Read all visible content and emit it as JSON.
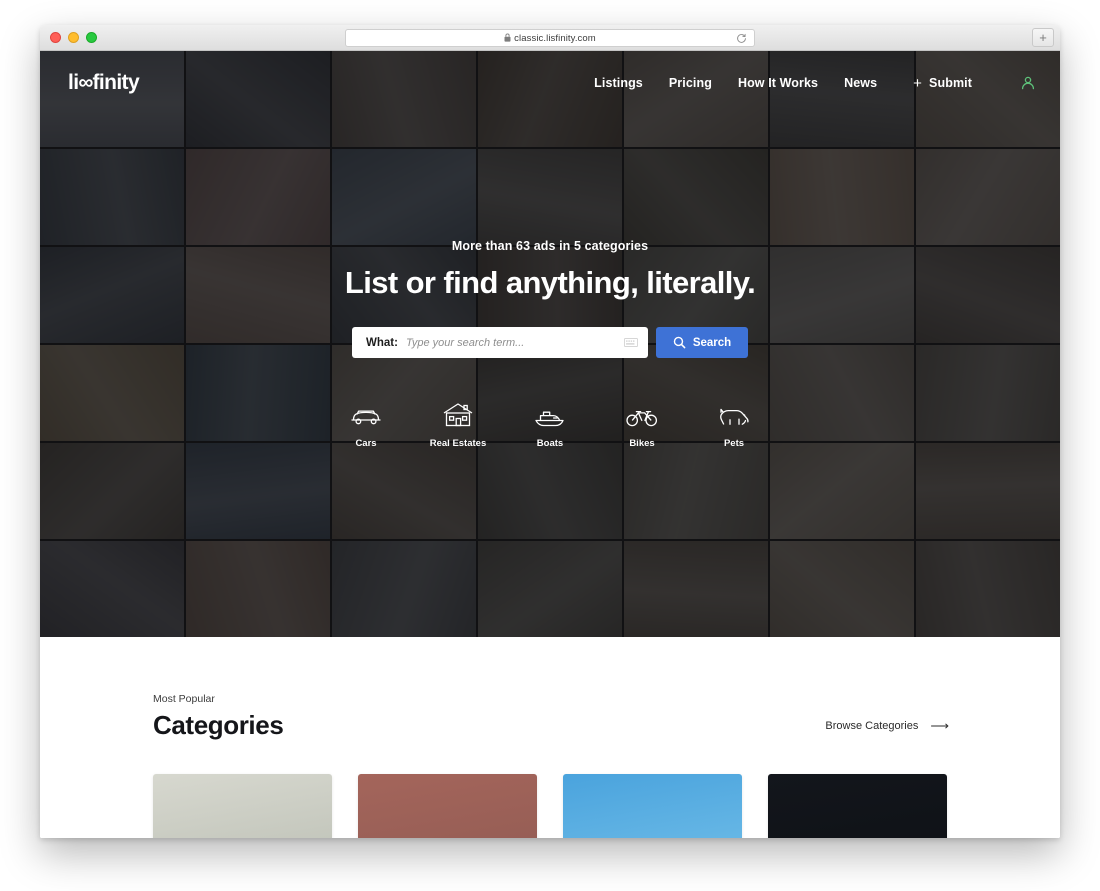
{
  "browser": {
    "url": "classic.lisfinity.com",
    "lock_icon": "lock-icon",
    "reload_icon": "reload-icon",
    "new_tab_label": "+",
    "traffic_lights": [
      "close",
      "minimize",
      "maximize"
    ]
  },
  "header": {
    "logo_pre": "li",
    "logo_infinity": "∞",
    "logo_post": "finity",
    "nav": [
      {
        "label": "Listings"
      },
      {
        "label": "Pricing"
      },
      {
        "label": "How It Works"
      },
      {
        "label": "News"
      }
    ],
    "submit": {
      "plus": "+",
      "label": "Submit"
    },
    "account_icon": "user-icon"
  },
  "hero": {
    "kicker": "More than 63 ads in 5 categories",
    "title": "List or find anything, literally.",
    "search": {
      "what_label": "What:",
      "placeholder": "Type your search term...",
      "value": "",
      "keyboard_icon": "keyboard-icon",
      "button_label": "Search",
      "button_icon": "search-icon",
      "button_color": "#3e72d6"
    },
    "shortcuts": [
      {
        "label": "Cars",
        "icon": "car-icon"
      },
      {
        "label": "Real Estates",
        "icon": "house-icon"
      },
      {
        "label": "Boats",
        "icon": "boat-icon"
      },
      {
        "label": "Bikes",
        "icon": "bicycle-icon"
      },
      {
        "label": "Pets",
        "icon": "dog-icon"
      }
    ],
    "overlay_color": "#0c0c0e",
    "mosaic": [
      "#5d6168",
      "#3a3d42",
      "#58514a",
      "#50473c",
      "#6a6258",
      "#4a4a48",
      "#6b6256",
      "#41484f",
      "#6b5a56",
      "#4a5560",
      "#52504b",
      "#4d4a40",
      "#7a6b5c",
      "#736a60",
      "#3c4249",
      "#6e6057",
      "#3e4348",
      "#4d463e",
      "#5b5a52",
      "#6d6a64",
      "#524c45",
      "#70644f",
      "#3b4852",
      "#6a6358",
      "#46433c",
      "#585043",
      "#6b645a",
      "#5e5a52",
      "#4f4a42",
      "#3f4a56",
      "#5a5248",
      "#4b4a44",
      "#5f5c53",
      "#736b5f",
      "#60584e",
      "#46464a",
      "#6a5b50",
      "#4c4f52",
      "#53514a",
      "#5d564c",
      "#6e6558",
      "#5a544c"
    ]
  },
  "content": {
    "kicker": "Most Popular",
    "title": "Categories",
    "browse_label": "Browse Categories",
    "browse_arrow": "⟶",
    "cards": [
      {
        "name": "card-one",
        "color_top": "#d7d8cf",
        "color_bottom": "#b9bdb2"
      },
      {
        "name": "card-two",
        "color_top": "#a4655b",
        "color_bottom": "#8f5a52"
      },
      {
        "name": "card-three",
        "color_top": "#4aa3dd",
        "color_bottom": "#76c2ea"
      },
      {
        "name": "card-four",
        "color_top": "#13161c",
        "color_bottom": "#0d1014"
      }
    ]
  }
}
